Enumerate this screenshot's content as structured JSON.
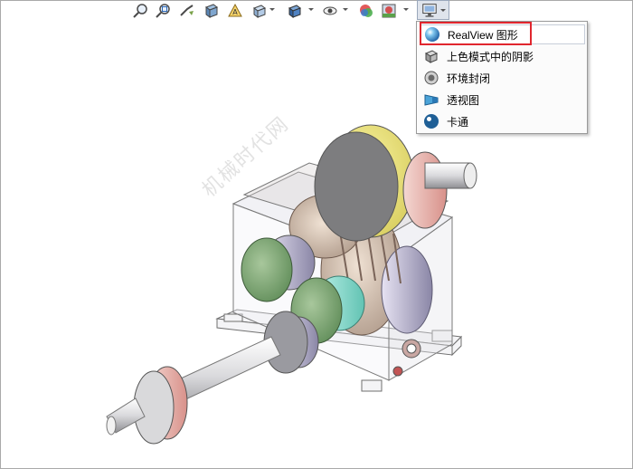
{
  "toolbar": {
    "buttons": [
      {
        "name": "zoom-to-fit-icon"
      },
      {
        "name": "zoom-to-area-icon"
      },
      {
        "name": "previous-view-icon"
      },
      {
        "name": "section-view-icon"
      },
      {
        "name": "dynamic-annotation-view-icon"
      },
      {
        "name": "view-orientation-icon"
      },
      {
        "name": "display-style-icon"
      },
      {
        "name": "hide-show-items-icon"
      },
      {
        "name": "edit-appearance-icon"
      },
      {
        "name": "apply-scene-icon"
      },
      {
        "name": "view-settings-icon"
      }
    ]
  },
  "menu": {
    "items": [
      {
        "label": "RealView 图形",
        "icon": "realview-sphere-icon",
        "selected": true
      },
      {
        "label": "上色模式中的阴影",
        "icon": "shadow-cube-icon"
      },
      {
        "label": "环境封闭",
        "icon": "ambient-occlusion-icon"
      },
      {
        "label": "透视图",
        "icon": "perspective-icon"
      },
      {
        "label": "卡通",
        "icon": "cartoon-icon"
      }
    ]
  },
  "watermark": {
    "text": "机械时代网"
  },
  "colors": {
    "highlight": "#e0262e",
    "menu_bg": "#fbfbfb",
    "menu_border": "#9a9a9a"
  }
}
